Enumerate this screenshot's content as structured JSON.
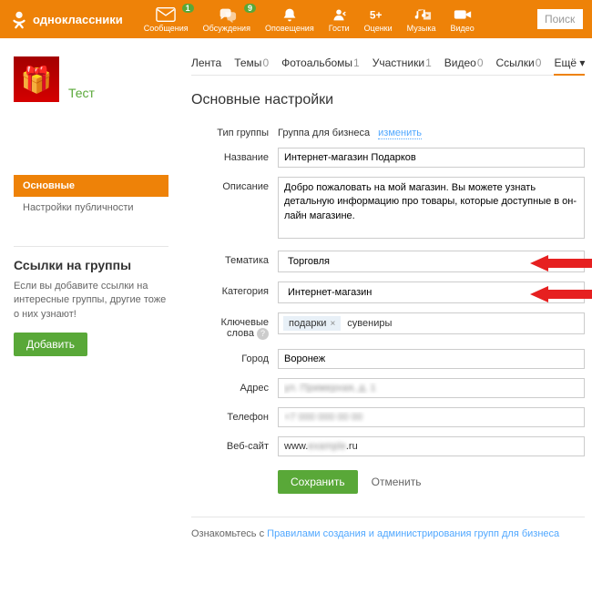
{
  "header": {
    "brand": "одноклассники",
    "nav": [
      {
        "label": "Сообщения",
        "badge": "1"
      },
      {
        "label": "Обсуждения",
        "badge": "9"
      },
      {
        "label": "Оповещения",
        "badge": ""
      },
      {
        "label": "Гости",
        "badge": ""
      },
      {
        "label": "Оценки",
        "badge": ""
      },
      {
        "label": "Музыка",
        "badge": ""
      },
      {
        "label": "Видео",
        "badge": ""
      }
    ],
    "search_placeholder": "Поиск"
  },
  "group": {
    "name": "Тест"
  },
  "tabs": [
    {
      "label": "Лента",
      "count": ""
    },
    {
      "label": "Темы",
      "count": "0"
    },
    {
      "label": "Фотоальбомы",
      "count": "1"
    },
    {
      "label": "Участники",
      "count": "1"
    },
    {
      "label": "Видео",
      "count": "0"
    },
    {
      "label": "Ссылки",
      "count": "0"
    },
    {
      "label": "Ещё ▾",
      "count": "",
      "active": true
    }
  ],
  "sidebar": {
    "items": [
      {
        "label": "Основные",
        "active": true
      },
      {
        "label": "Настройки публичности",
        "active": false
      }
    ],
    "links_title": "Ссылки на группы",
    "links_desc": "Если вы добавите ссылки на интересные группы, другие тоже о них узнают!",
    "add_btn": "Добавить"
  },
  "form": {
    "title": "Основные настройки",
    "type_label": "Тип группы",
    "type_value": "Группа для бизнеса",
    "change": "изменить",
    "name_label": "Название",
    "name_value": "Интернет-магазин Подарков",
    "desc_label": "Описание",
    "desc_value": "Добро пожаловать на мой магазин. Вы можете узнать детальную информацию про товары, которые доступные в он-лайн магазине.",
    "theme_label": "Тематика",
    "theme_value": "Торговля",
    "cat_label": "Категория",
    "cat_value": "Интернет-магазин",
    "kw_label": "Ключевые слова",
    "kw_tag": "подарки",
    "kw_text": "сувениры",
    "city_label": "Город",
    "city_value": "Воронеж",
    "addr_label": "Адрес",
    "addr_value": "ул. Примерная, д. 1",
    "phone_label": "Телефон",
    "phone_value": "+7 000 000 00 00",
    "site_label": "Веб-сайт",
    "site_prefix": "www.",
    "site_suffix": ".ru",
    "site_mid": "example",
    "save": "Сохранить",
    "cancel": "Отменить"
  },
  "footer": {
    "prefix": "Ознакомьтесь с ",
    "link": "Правилами создания и администрирования групп для бизнеса"
  }
}
